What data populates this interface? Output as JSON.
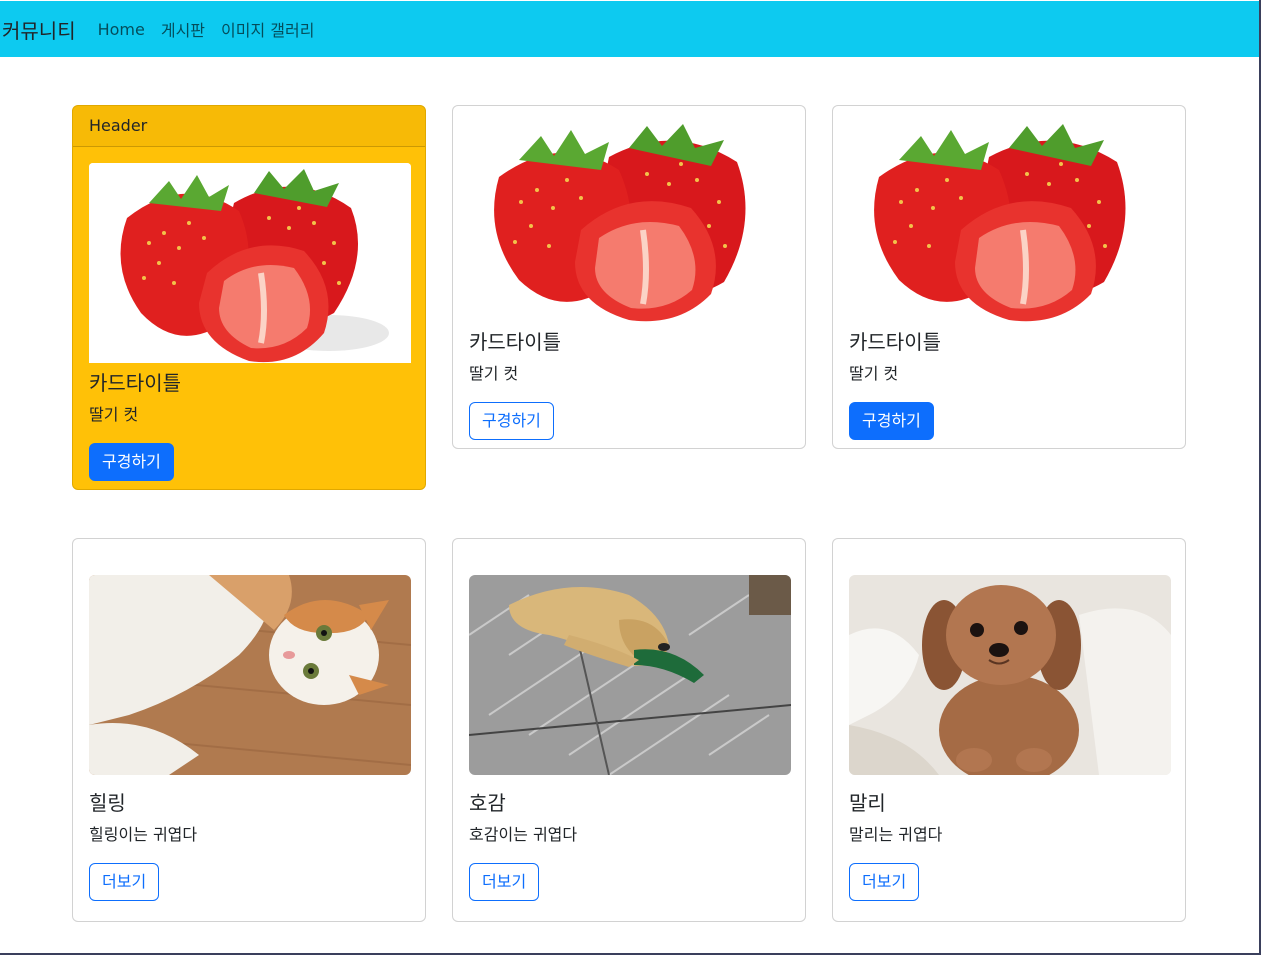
{
  "navbar": {
    "brand": "커뮤니티",
    "links": [
      "Home",
      "게시판",
      "이미지 갤러리"
    ]
  },
  "colors": {
    "navbar_bg": "#0dcaf0",
    "warning_card_bg": "#ffc107",
    "primary": "#0d6efd"
  },
  "strawberry_cards": [
    {
      "header": "Header",
      "title": "카드타이틀",
      "text": "딸기 컷",
      "button": "구경하기"
    },
    {
      "title": "카드타이틀",
      "text": "딸기 컷",
      "button": "구경하기"
    },
    {
      "title": "카드타이틀",
      "text": "딸기 컷",
      "button": "구경하기"
    }
  ],
  "pet_cards": [
    {
      "title": "힐링",
      "text": "힐링이는 귀엽다",
      "button": "더보기"
    },
    {
      "title": "호감",
      "text": "호감이는 귀엽다",
      "button": "더보기"
    },
    {
      "title": "말리",
      "text": "말리는 귀엽다",
      "button": "더보기"
    }
  ]
}
